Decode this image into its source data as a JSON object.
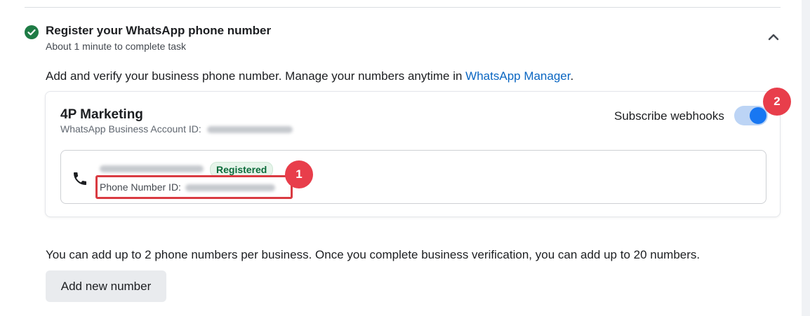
{
  "task": {
    "title": "Register your WhatsApp phone number",
    "subtitle": "About 1 minute to complete task"
  },
  "description": {
    "text": "Add and verify your business phone number. Manage your numbers anytime in ",
    "link": "WhatsApp Manager",
    "end": "."
  },
  "account": {
    "name": "4P Marketing",
    "waba_label": "WhatsApp Business Account ID:"
  },
  "webhooks": {
    "label": "Subscribe webhooks",
    "enabled": true
  },
  "phone": {
    "status_badge": "Registered",
    "id_label": "Phone Number ID:"
  },
  "markers": {
    "one": "1",
    "two": "2"
  },
  "footnote": "You can add up to 2 phone numbers per business. Once you complete business verification, you can add up to 20 numbers.",
  "actions": {
    "add_new_number": "Add new number"
  },
  "colors": {
    "accent": "#1877f2",
    "link": "#0a66c2",
    "success": "#0b6b3a",
    "marker": "#e83e4b",
    "highlight_border": "#d93b42"
  }
}
